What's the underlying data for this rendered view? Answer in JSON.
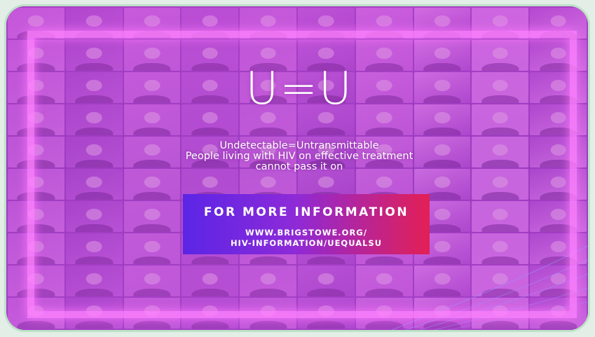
{
  "logo_text": "U=U",
  "tagline": {
    "line1": "Undetectable=Untransmittable",
    "line2": "People living with HIV on effective treatment",
    "line3": "cannot pass it on"
  },
  "info": {
    "title": "FOR MORE INFORMATION",
    "url_line1": "WWW.BRIGSTOWE.ORG/",
    "url_line2": "HIV-INFORMATION/UEQUALSU"
  },
  "colors": {
    "background": "#e3eee7",
    "card_border": "#bde3c6",
    "purple_tint": "#b84ad6",
    "frame_glow": "#ff82ff",
    "banner_left": "#5b25e6",
    "banner_right": "#e31f55",
    "text": "#ffffff"
  }
}
